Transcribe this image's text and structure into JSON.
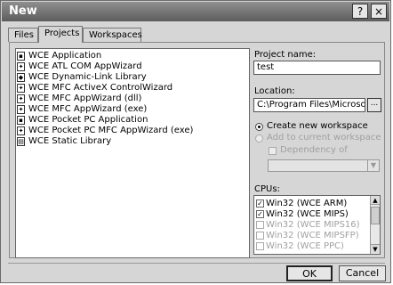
{
  "window": {
    "title": "New",
    "help_glyph": "?",
    "close_glyph": "×"
  },
  "tabs": [
    {
      "label": "Files"
    },
    {
      "label": "Projects"
    },
    {
      "label": "Workspaces"
    }
  ],
  "project_types": [
    {
      "label": "WCE Application",
      "icon": "application-icon"
    },
    {
      "label": "WCE ATL COM AppWizard",
      "icon": "atl-com-wizard-icon"
    },
    {
      "label": "WCE Dynamic-Link Library",
      "icon": "dll-icon"
    },
    {
      "label": "WCE MFC ActiveX ControlWizard",
      "icon": "activex-wizard-icon"
    },
    {
      "label": "WCE MFC AppWizard (dll)",
      "icon": "mfc-dll-wizard-icon"
    },
    {
      "label": "WCE MFC AppWizard (exe)",
      "icon": "mfc-exe-wizard-icon"
    },
    {
      "label": "WCE Pocket PC Application",
      "icon": "pocketpc-app-icon"
    },
    {
      "label": "WCE Pocket PC MFC AppWizard (exe)",
      "icon": "pocketpc-mfc-wizard-icon"
    },
    {
      "label": "WCE Static Library",
      "icon": "static-library-icon"
    }
  ],
  "project_name": {
    "label": "Project name:",
    "value": "test"
  },
  "location": {
    "label": "Location:",
    "value": "C:\\Program Files\\Microsoft eMb",
    "browse_label": "..."
  },
  "workspace_options": {
    "create_new": "Create new workspace",
    "add_current": "Add to current workspace",
    "dependency": "Dependency of"
  },
  "cpus": {
    "label": "CPUs:",
    "items": [
      {
        "label": "Win32 (WCE ARM)",
        "checked": true,
        "enabled": true
      },
      {
        "label": "Win32 (WCE MIPS)",
        "checked": true,
        "enabled": true
      },
      {
        "label": "Win32 (WCE MIPS16)",
        "checked": false,
        "enabled": false
      },
      {
        "label": "Win32 (WCE MIPSFP)",
        "checked": false,
        "enabled": false
      },
      {
        "label": "Win32 (WCE PPC)",
        "checked": false,
        "enabled": false
      }
    ]
  },
  "buttons": {
    "ok": "OK",
    "cancel": "Cancel"
  }
}
